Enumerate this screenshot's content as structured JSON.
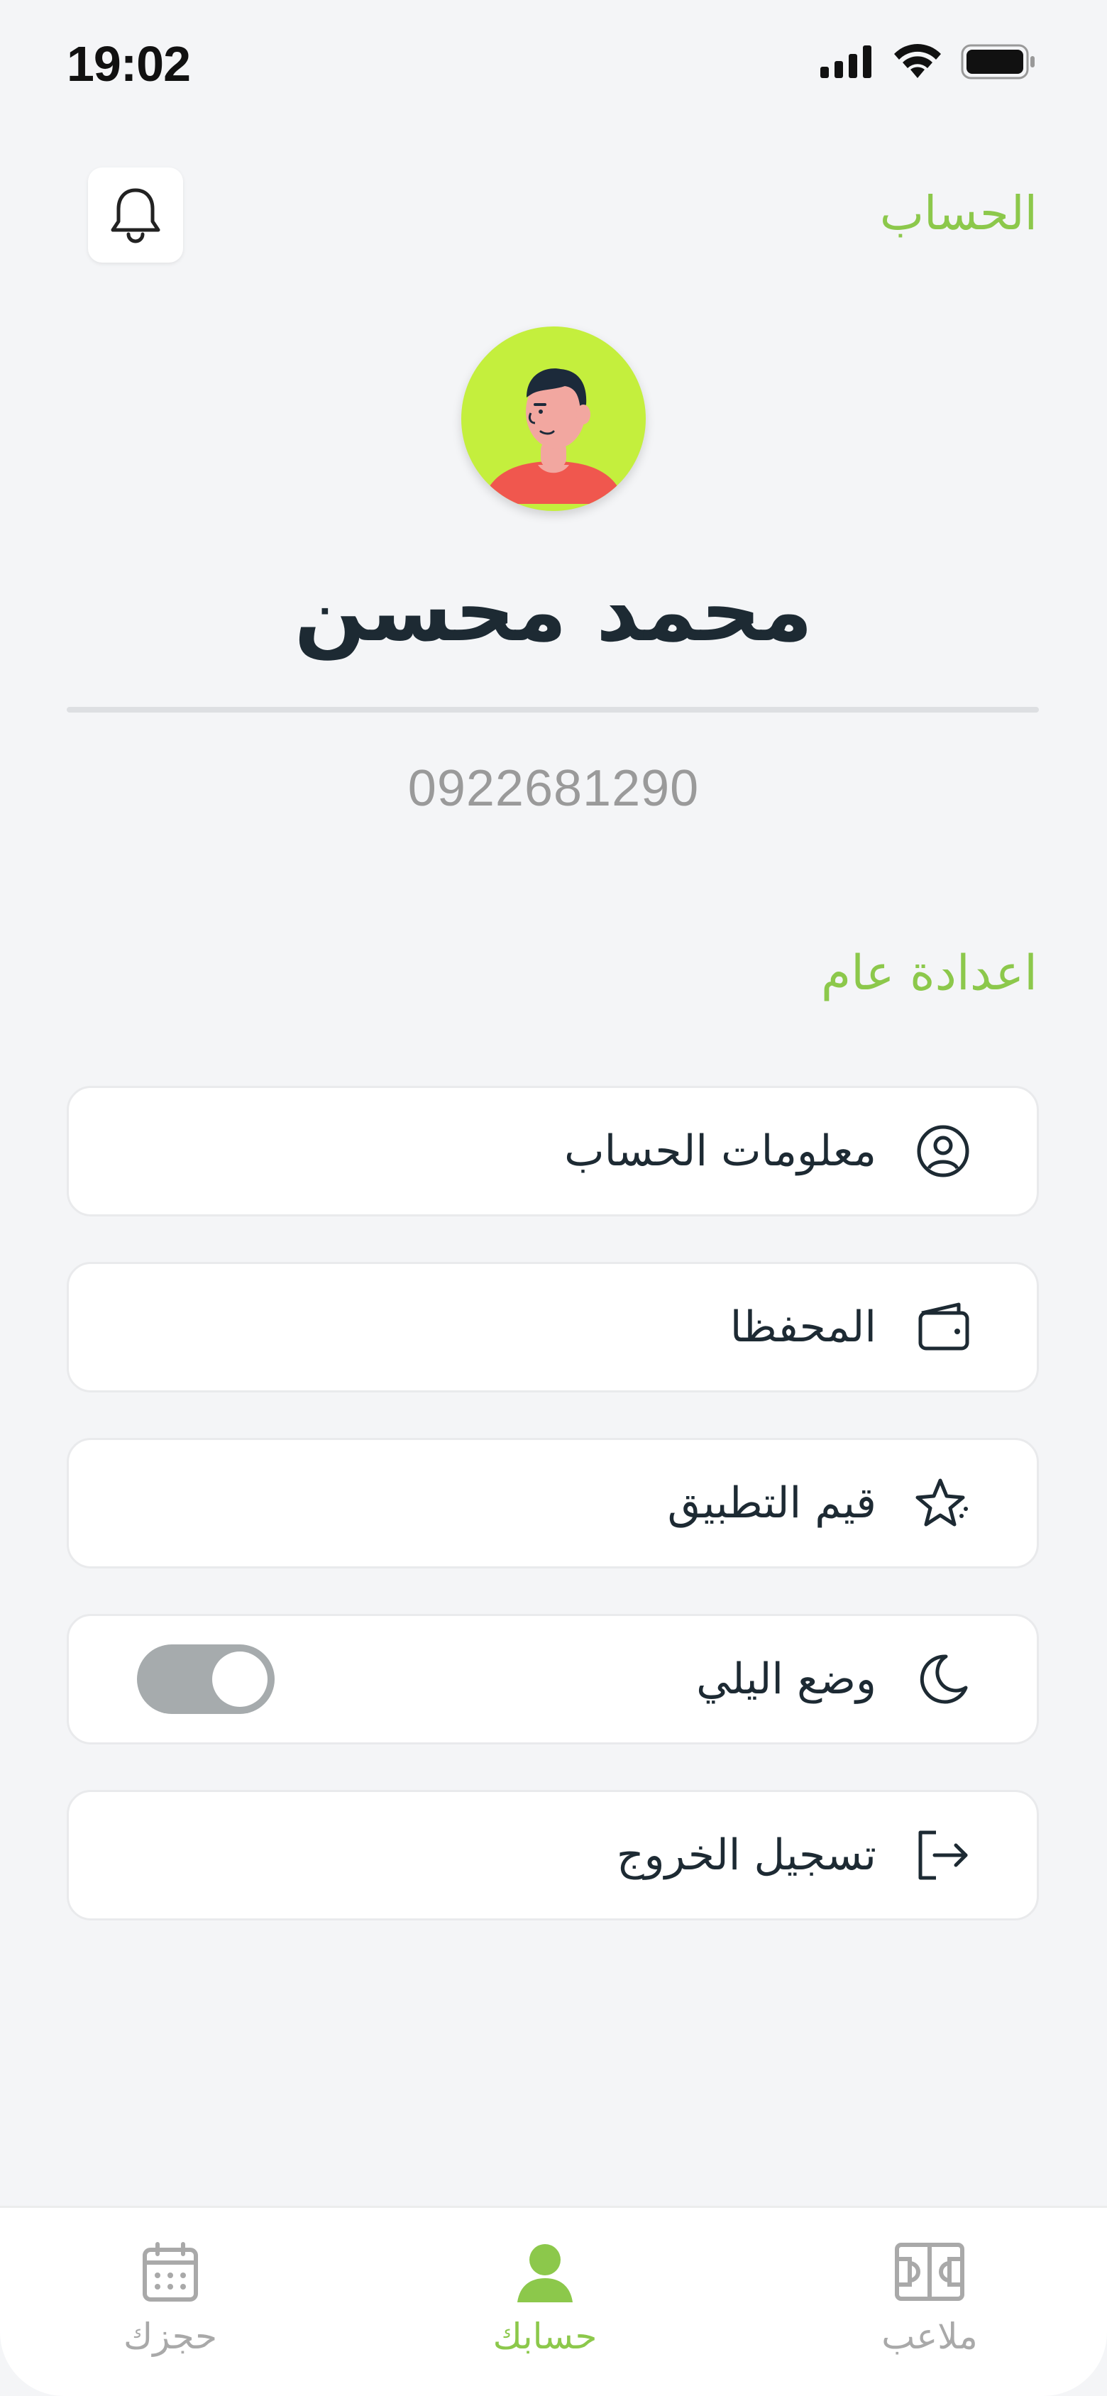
{
  "status_bar": {
    "time": "19:02"
  },
  "header": {
    "title": "الحساب",
    "bell_icon": "bell-icon"
  },
  "profile": {
    "name": "محمد محسن",
    "phone": "0922681290",
    "avatar_bg": "#c4ef3d"
  },
  "settings": {
    "section_title": "اعدادة عام",
    "items": [
      {
        "label": "معلومات الحساب",
        "icon": "user-circle-icon"
      },
      {
        "label": "المحفظا",
        "icon": "wallet-icon"
      },
      {
        "label": "قيم التطبيق",
        "icon": "star-icon"
      },
      {
        "label": "وضع اليلي",
        "icon": "moon-icon",
        "toggle_on": false
      },
      {
        "label": "تسجيل الخروج",
        "icon": "logout-icon"
      }
    ]
  },
  "bottom_nav": {
    "items": [
      {
        "label": "ملاعب",
        "icon": "court-icon",
        "active": false
      },
      {
        "label": "حسابك",
        "icon": "user-icon",
        "active": true
      },
      {
        "label": "حجزك",
        "icon": "calendar-icon",
        "active": false
      }
    ]
  },
  "colors": {
    "accent": "#8cc84b",
    "text_dark": "#1d2a33",
    "muted": "#a9a9a9",
    "background": "#f4f5f7"
  }
}
